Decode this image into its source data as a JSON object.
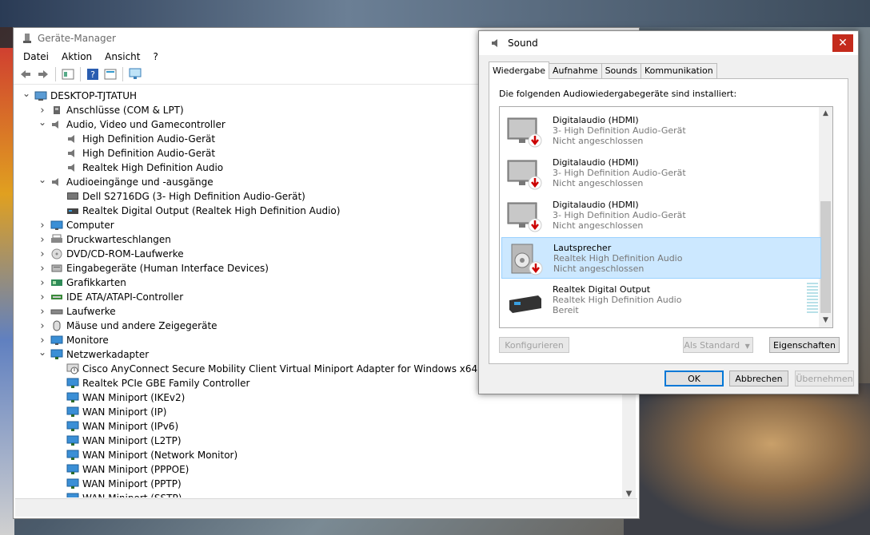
{
  "device_manager": {
    "title": "Geräte-Manager",
    "menu": [
      "Datei",
      "Aktion",
      "Ansicht",
      "?"
    ],
    "toolbar_icons": [
      "back-icon",
      "forward-icon",
      "properties-icon",
      "help-icon",
      "show-hidden-icon",
      "monitor-scan-icon"
    ],
    "tree": [
      {
        "label": "DESKTOP-TJTATUH",
        "level": 0,
        "exp": "open",
        "icon": "computer-icon"
      },
      {
        "label": "Anschlüsse (COM & LPT)",
        "level": 1,
        "exp": "closed",
        "icon": "port-icon"
      },
      {
        "label": "Audio, Video und Gamecontroller",
        "level": 1,
        "exp": "open",
        "icon": "speaker-icon"
      },
      {
        "label": "High Definition Audio-Gerät",
        "level": 2,
        "exp": "none",
        "icon": "speaker-icon"
      },
      {
        "label": "High Definition Audio-Gerät",
        "level": 2,
        "exp": "none",
        "icon": "speaker-icon"
      },
      {
        "label": "Realtek High Definition Audio",
        "level": 2,
        "exp": "none",
        "icon": "speaker-icon"
      },
      {
        "label": "Audioeingänge und -ausgänge",
        "level": 1,
        "exp": "open",
        "icon": "speaker-icon"
      },
      {
        "label": "Dell S2716DG (3- High Definition Audio-Gerät)",
        "level": 2,
        "exp": "none",
        "icon": "display-audio-icon"
      },
      {
        "label": "Realtek Digital Output (Realtek High Definition Audio)",
        "level": 2,
        "exp": "none",
        "icon": "digital-output-icon"
      },
      {
        "label": "Computer",
        "level": 1,
        "exp": "closed",
        "icon": "monitor-icon"
      },
      {
        "label": "Druckwarteschlangen",
        "level": 1,
        "exp": "closed",
        "icon": "printer-icon"
      },
      {
        "label": "DVD/CD-ROM-Laufwerke",
        "level": 1,
        "exp": "closed",
        "icon": "dvd-icon"
      },
      {
        "label": "Eingabegeräte (Human Interface Devices)",
        "level": 1,
        "exp": "closed",
        "icon": "hid-icon"
      },
      {
        "label": "Grafikkarten",
        "level": 1,
        "exp": "closed",
        "icon": "graphics-icon"
      },
      {
        "label": "IDE ATA/ATAPI-Controller",
        "level": 1,
        "exp": "closed",
        "icon": "ide-icon"
      },
      {
        "label": "Laufwerke",
        "level": 1,
        "exp": "closed",
        "icon": "drive-icon"
      },
      {
        "label": "Mäuse und andere Zeigegeräte",
        "level": 1,
        "exp": "closed",
        "icon": "mouse-icon"
      },
      {
        "label": "Monitore",
        "level": 1,
        "exp": "closed",
        "icon": "monitor-icon"
      },
      {
        "label": "Netzwerkadapter",
        "level": 1,
        "exp": "open",
        "icon": "network-icon"
      },
      {
        "label": "Cisco AnyConnect Secure Mobility Client Virtual Miniport Adapter for Windows x64",
        "level": 2,
        "exp": "none",
        "icon": "network-warning-icon"
      },
      {
        "label": "Realtek PCIe GBE Family Controller",
        "level": 2,
        "exp": "none",
        "icon": "network-icon"
      },
      {
        "label": "WAN Miniport (IKEv2)",
        "level": 2,
        "exp": "none",
        "icon": "network-icon"
      },
      {
        "label": "WAN Miniport (IP)",
        "level": 2,
        "exp": "none",
        "icon": "network-icon"
      },
      {
        "label": "WAN Miniport (IPv6)",
        "level": 2,
        "exp": "none",
        "icon": "network-icon"
      },
      {
        "label": "WAN Miniport (L2TP)",
        "level": 2,
        "exp": "none",
        "icon": "network-icon"
      },
      {
        "label": "WAN Miniport (Network Monitor)",
        "level": 2,
        "exp": "none",
        "icon": "network-icon"
      },
      {
        "label": "WAN Miniport (PPPOE)",
        "level": 2,
        "exp": "none",
        "icon": "network-icon"
      },
      {
        "label": "WAN Miniport (PPTP)",
        "level": 2,
        "exp": "none",
        "icon": "network-icon"
      },
      {
        "label": "WAN Miniport (SSTP)",
        "level": 2,
        "exp": "none",
        "icon": "network-icon"
      }
    ]
  },
  "sound": {
    "title": "Sound",
    "close_glyph": "✕",
    "tabs": [
      "Wiedergabe",
      "Aufnahme",
      "Sounds",
      "Kommunikation"
    ],
    "active_tab": "Wiedergabe",
    "instruction": "Die folgenden Audiowiedergabegeräte sind installiert:",
    "devices": [
      {
        "name": "Digitalaudio (HDMI)",
        "sub": "3- High Definition Audio-Gerät",
        "status": "Nicht angeschlossen",
        "icon": "hdmi-monitor-icon",
        "selected": false
      },
      {
        "name": "Digitalaudio (HDMI)",
        "sub": "3- High Definition Audio-Gerät",
        "status": "Nicht angeschlossen",
        "icon": "hdmi-monitor-icon",
        "selected": false
      },
      {
        "name": "Digitalaudio (HDMI)",
        "sub": "3- High Definition Audio-Gerät",
        "status": "Nicht angeschlossen",
        "icon": "hdmi-monitor-icon",
        "selected": false
      },
      {
        "name": "Lautsprecher",
        "sub": "Realtek High Definition Audio",
        "status": "Nicht angeschlossen",
        "icon": "speaker-box-icon",
        "selected": true
      },
      {
        "name": "Realtek Digital Output",
        "sub": "Realtek High Definition Audio",
        "status": "Bereit",
        "icon": "digital-output-box-icon",
        "selected": false
      }
    ],
    "buttons": {
      "configure": "Konfigurieren",
      "set_default": "Als Standard",
      "properties": "Eigenschaften",
      "ok": "OK",
      "cancel": "Abbrechen",
      "apply": "Übernehmen"
    }
  }
}
